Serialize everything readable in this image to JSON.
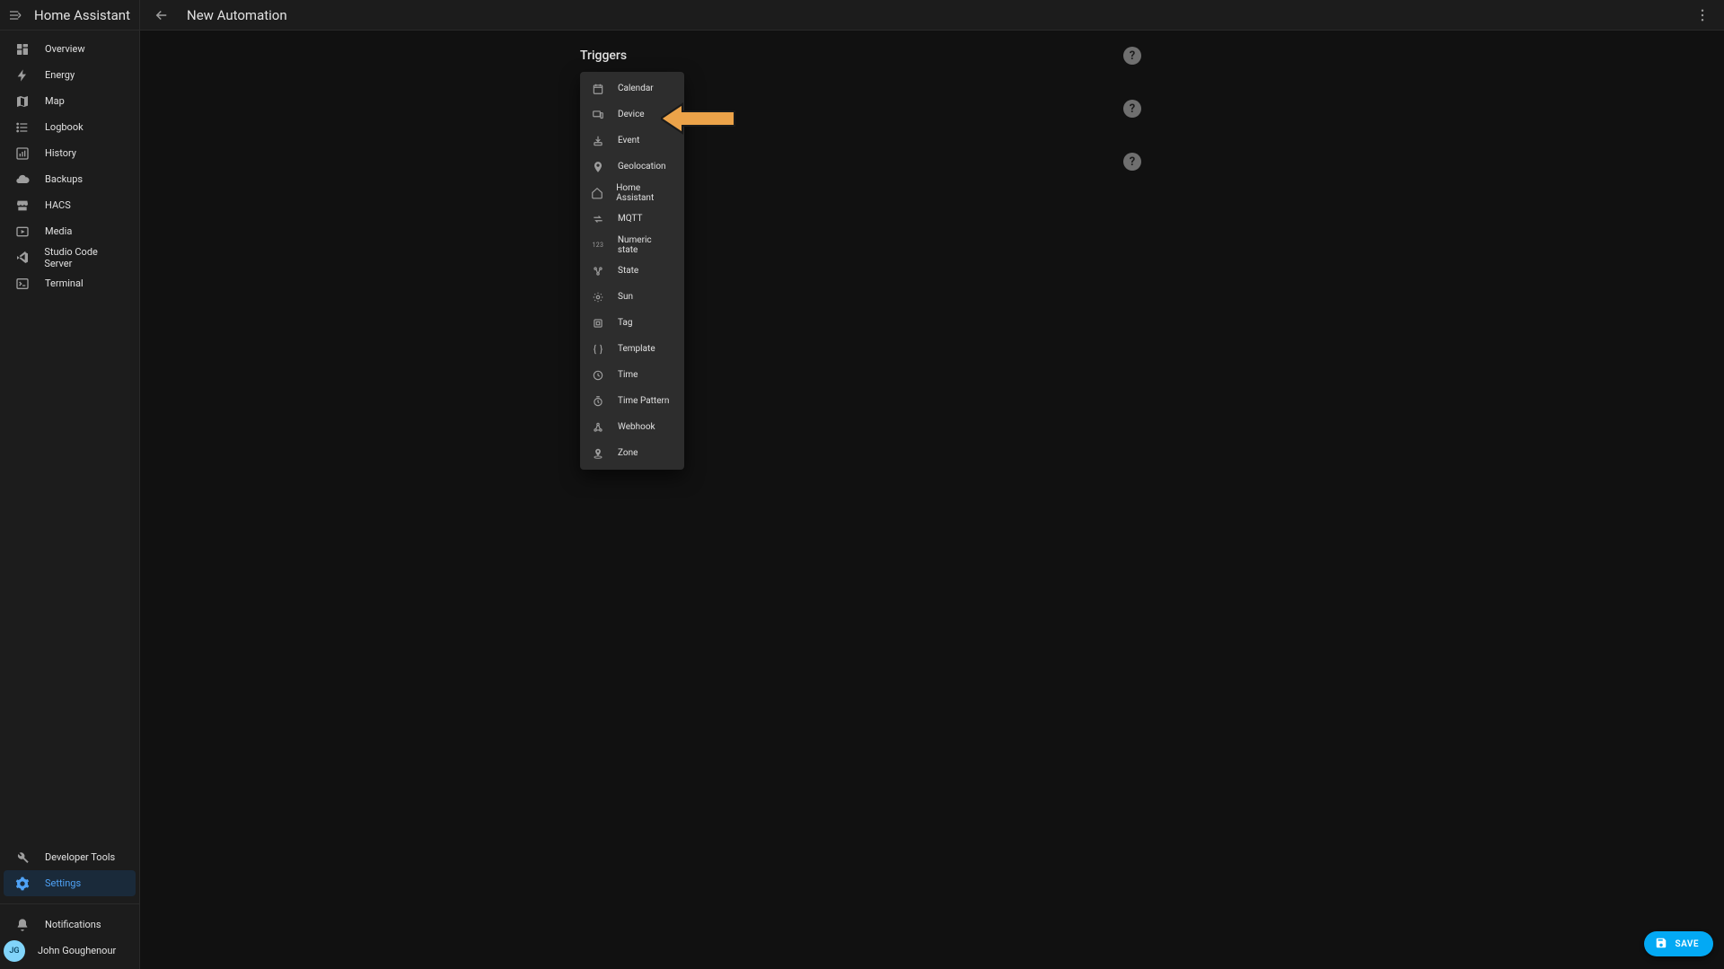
{
  "brand": "Home Assistant",
  "page": {
    "title": "New Automation"
  },
  "sidebar": {
    "items": [
      {
        "label": "Overview",
        "icon": "dashboard"
      },
      {
        "label": "Energy",
        "icon": "bolt"
      },
      {
        "label": "Map",
        "icon": "map"
      },
      {
        "label": "Logbook",
        "icon": "list"
      },
      {
        "label": "History",
        "icon": "chart"
      },
      {
        "label": "Backups",
        "icon": "cloud"
      },
      {
        "label": "HACS",
        "icon": "store"
      },
      {
        "label": "Media",
        "icon": "media"
      },
      {
        "label": "Studio Code Server",
        "icon": "vscode"
      },
      {
        "label": "Terminal",
        "icon": "terminal"
      }
    ],
    "bottom": [
      {
        "label": "Developer Tools",
        "icon": "wrench",
        "selected": false
      },
      {
        "label": "Settings",
        "icon": "gear",
        "selected": true
      }
    ],
    "notifications_label": "Notifications"
  },
  "user": {
    "name": "John Goughenour",
    "initials": "JG"
  },
  "section": {
    "triggers_label": "Triggers"
  },
  "dropdown": {
    "items": [
      {
        "label": "Calendar"
      },
      {
        "label": "Device"
      },
      {
        "label": "Event"
      },
      {
        "label": "Geolocation"
      },
      {
        "label": "Home Assistant"
      },
      {
        "label": "MQTT"
      },
      {
        "label": "Numeric state"
      },
      {
        "label": "State"
      },
      {
        "label": "Sun"
      },
      {
        "label": "Tag"
      },
      {
        "label": "Template"
      },
      {
        "label": "Time"
      },
      {
        "label": "Time Pattern"
      },
      {
        "label": "Webhook"
      },
      {
        "label": "Zone"
      }
    ],
    "highlighted_index": 1
  },
  "save_button_label": "SAVE"
}
